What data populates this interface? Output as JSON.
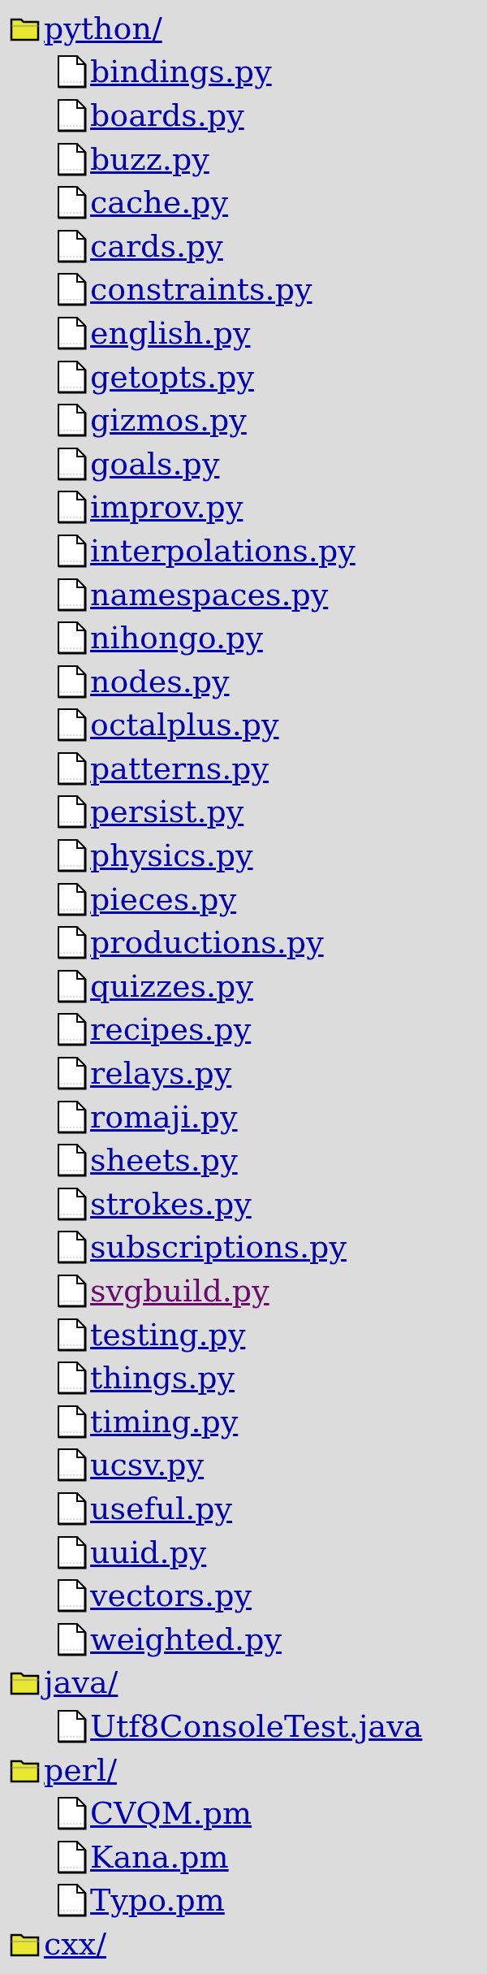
{
  "tree": [
    {
      "kind": "folder",
      "name": "python/",
      "visited": false,
      "children": [
        {
          "kind": "file",
          "name": "bindings.py",
          "visited": false
        },
        {
          "kind": "file",
          "name": "boards.py",
          "visited": false
        },
        {
          "kind": "file",
          "name": "buzz.py",
          "visited": false
        },
        {
          "kind": "file",
          "name": "cache.py",
          "visited": false
        },
        {
          "kind": "file",
          "name": "cards.py",
          "visited": false
        },
        {
          "kind": "file",
          "name": "constraints.py",
          "visited": false
        },
        {
          "kind": "file",
          "name": "english.py",
          "visited": false
        },
        {
          "kind": "file",
          "name": "getopts.py",
          "visited": false
        },
        {
          "kind": "file",
          "name": "gizmos.py",
          "visited": false
        },
        {
          "kind": "file",
          "name": "goals.py",
          "visited": false
        },
        {
          "kind": "file",
          "name": "improv.py",
          "visited": false
        },
        {
          "kind": "file",
          "name": "interpolations.py",
          "visited": false
        },
        {
          "kind": "file",
          "name": "namespaces.py",
          "visited": false
        },
        {
          "kind": "file",
          "name": "nihongo.py",
          "visited": false
        },
        {
          "kind": "file",
          "name": "nodes.py",
          "visited": false
        },
        {
          "kind": "file",
          "name": "octalplus.py",
          "visited": false
        },
        {
          "kind": "file",
          "name": "patterns.py",
          "visited": false
        },
        {
          "kind": "file",
          "name": "persist.py",
          "visited": false
        },
        {
          "kind": "file",
          "name": "physics.py",
          "visited": false
        },
        {
          "kind": "file",
          "name": "pieces.py",
          "visited": false
        },
        {
          "kind": "file",
          "name": "productions.py",
          "visited": false
        },
        {
          "kind": "file",
          "name": "quizzes.py",
          "visited": false
        },
        {
          "kind": "file",
          "name": "recipes.py",
          "visited": false
        },
        {
          "kind": "file",
          "name": "relays.py",
          "visited": false
        },
        {
          "kind": "file",
          "name": "romaji.py",
          "visited": false
        },
        {
          "kind": "file",
          "name": "sheets.py",
          "visited": false
        },
        {
          "kind": "file",
          "name": "strokes.py",
          "visited": false
        },
        {
          "kind": "file",
          "name": "subscriptions.py",
          "visited": false
        },
        {
          "kind": "file",
          "name": "svgbuild.py",
          "visited": true
        },
        {
          "kind": "file",
          "name": "testing.py",
          "visited": false
        },
        {
          "kind": "file",
          "name": "things.py",
          "visited": false
        },
        {
          "kind": "file",
          "name": "timing.py",
          "visited": false
        },
        {
          "kind": "file",
          "name": "ucsv.py",
          "visited": false
        },
        {
          "kind": "file",
          "name": "useful.py",
          "visited": false
        },
        {
          "kind": "file",
          "name": "uuid.py",
          "visited": false
        },
        {
          "kind": "file",
          "name": "vectors.py",
          "visited": false
        },
        {
          "kind": "file",
          "name": "weighted.py",
          "visited": false
        }
      ]
    },
    {
      "kind": "folder",
      "name": "java/",
      "visited": false,
      "children": [
        {
          "kind": "file",
          "name": "Utf8ConsoleTest.java",
          "visited": false
        }
      ]
    },
    {
      "kind": "folder",
      "name": "perl/",
      "visited": false,
      "children": [
        {
          "kind": "file",
          "name": "CVQM.pm",
          "visited": false
        },
        {
          "kind": "file",
          "name": "Kana.pm",
          "visited": false
        },
        {
          "kind": "file",
          "name": "Typo.pm",
          "visited": false
        }
      ]
    },
    {
      "kind": "folder",
      "name": "cxx/",
      "visited": false
    }
  ]
}
